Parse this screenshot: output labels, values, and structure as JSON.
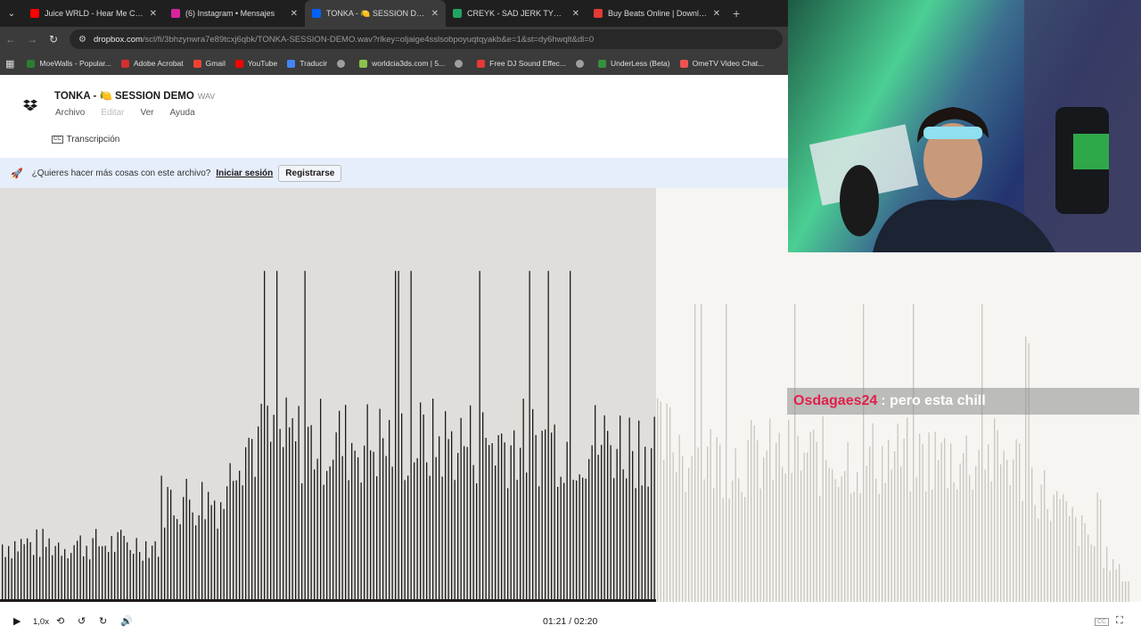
{
  "browser": {
    "tabs": [
      {
        "label": "Juice WRLD - Hear Me Calling",
        "favicon_color": "#ff0000",
        "active": false
      },
      {
        "label": "(6) Instagram • Mensajes",
        "favicon_color": "#d6249f",
        "active": false
      },
      {
        "label": "TONKA - 🍋 SESSION DEMO.wav",
        "favicon_color": "#0061fe",
        "active": true
      },
      {
        "label": "CREYK - SAD JERK TYPE BEAT",
        "favicon_color": "#1fa463",
        "active": false
      },
      {
        "label": "Buy Beats Online | Download B",
        "favicon_color": "#e53935",
        "active": false
      }
    ],
    "url_host": "dropbox.com",
    "url_path": "/scl/fi/3bhzynwra7e89tcxj6qbk/TONKA-SESSION-DEMO.wav?rlkey=oljaige4sslsobpoyuqtqyakb&e=1&st=dy6hwqlt&dl=0",
    "bookmarks": [
      {
        "label": "MoeWalls - Popular...",
        "color": "#2e7d32"
      },
      {
        "label": "Adobe Acrobat",
        "color": "#d32f2f"
      },
      {
        "label": "Gmail",
        "color": "#ea4335"
      },
      {
        "label": "YouTube",
        "color": "#ff0000"
      },
      {
        "label": "Traducir",
        "color": "#4285f4"
      },
      {
        "label": "",
        "color": "#9e9e9e"
      },
      {
        "label": "worldcia3ds.com | 5...",
        "color": "#8bc34a"
      },
      {
        "label": "",
        "color": "#9e9e9e"
      },
      {
        "label": "Free DJ Sound Effec...",
        "color": "#e53935"
      },
      {
        "label": "",
        "color": "#9e9e9e"
      },
      {
        "label": "UnderLess (Beta)",
        "color": "#388e3c"
      },
      {
        "label": "OmeTV Video Chat...",
        "color": "#ef5350"
      }
    ]
  },
  "file": {
    "title": "TONKA - 🍋 SESSION DEMO",
    "ext": "WAV",
    "menus": [
      "Archivo",
      "Editar",
      "Ver",
      "Ayuda"
    ],
    "transcript_label": "Transcripción",
    "cc_badge": "CC"
  },
  "banner": {
    "question": "¿Quieres hacer más cosas con este archivo?",
    "login": "Iniciar sesión",
    "signup": "Registrarse"
  },
  "player": {
    "speed": "1,0x",
    "time": "01:21 / 02:20",
    "progress": 0.575,
    "skip_seconds": "10"
  },
  "chat": {
    "user": "Osdagaes24",
    "message": ": pero esta chill"
  },
  "colors": {
    "accent": "#0061fe",
    "waveform_played": "#1e1919",
    "waveform_unplayed": "#c9c6c0"
  }
}
